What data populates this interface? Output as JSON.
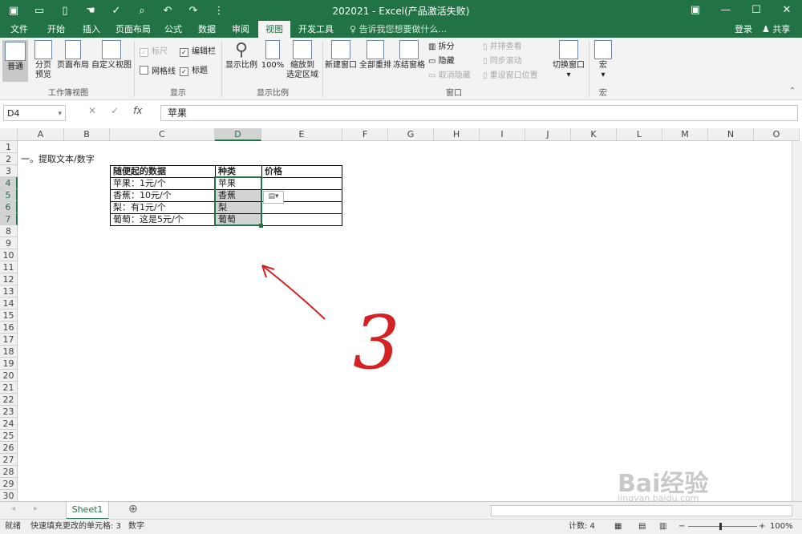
{
  "title_bar": {
    "title": "202021 - Excel(产品激活失败)"
  },
  "menu": {
    "tabs": [
      "文件",
      "开始",
      "插入",
      "页面布局",
      "公式",
      "数据",
      "审阅",
      "视图",
      "开发工具"
    ],
    "active_tab": "视图",
    "tell_me": "告诉我您想要做什么...",
    "login": "登录",
    "share": "共享"
  },
  "ribbon": {
    "normal": "普通",
    "page_break_1": "分页",
    "page_break_2": "预览",
    "page_layout": "页面布局",
    "custom_view": "自定义视图",
    "group_workbook_views": "工作簿视图",
    "ruler": "标尺",
    "formula_bar": "编辑栏",
    "gridlines": "网格线",
    "headings": "标题",
    "group_show": "显示",
    "zoom": "显示比例",
    "zoom_100": "100%",
    "zoom_sel_1": "缩放到",
    "zoom_sel_2": "选定区域",
    "group_zoom": "显示比例",
    "new_window": "新建窗口",
    "arrange_all": "全部重排",
    "freeze_panes": "冻结窗格",
    "split": "拆分",
    "hide": "隐藏",
    "unhide": "取消隐藏",
    "side_by_side": "并排查看",
    "sync_scroll": "同步滚动",
    "reset_pos": "重设窗口位置",
    "group_window": "窗口",
    "switch_windows": "切换窗口",
    "macros": "宏",
    "group_macros": "宏"
  },
  "formula_bar": {
    "name_box": "D4",
    "fx": "fx",
    "value": "苹果"
  },
  "columns": [
    "A",
    "B",
    "C",
    "D",
    "E",
    "F",
    "G",
    "H",
    "I",
    "J",
    "K",
    "L",
    "M",
    "N",
    "O"
  ],
  "rows": [
    "1",
    "2",
    "3",
    "4",
    "5",
    "6",
    "7",
    "8",
    "9",
    "10",
    "11",
    "12",
    "13",
    "14",
    "15",
    "16",
    "17",
    "18",
    "19",
    "20",
    "21",
    "22",
    "23",
    "24",
    "25",
    "26",
    "27",
    "28",
    "29",
    "30"
  ],
  "cells": {
    "a2": "一。提取文本/数字",
    "c3": "随便起的数据",
    "d3": "种类",
    "e3": "价格",
    "c4": "苹果：1元/个",
    "d4": "苹果",
    "c5": "香蕉：10元/个",
    "d5": "香蕉",
    "c6": "梨：有1元/个",
    "d6": "梨",
    "c7": "葡萄：这是5元/个",
    "d7": "葡萄"
  },
  "annotation": {
    "handwritten_text": "3"
  },
  "sheet_tab": "Sheet1",
  "status": {
    "ready": "就绪",
    "flash_fill": "快速填充更改的单元格: 3",
    "mode": "数字",
    "count": "计数: 4",
    "zoom": "100%"
  },
  "watermark": {
    "line1": "Bai经验",
    "line2": "jingyan.baidu.com"
  },
  "colors": {
    "excel_green": "#217346",
    "selection": "#d3d3d3",
    "arrow_red": "#d42222"
  }
}
